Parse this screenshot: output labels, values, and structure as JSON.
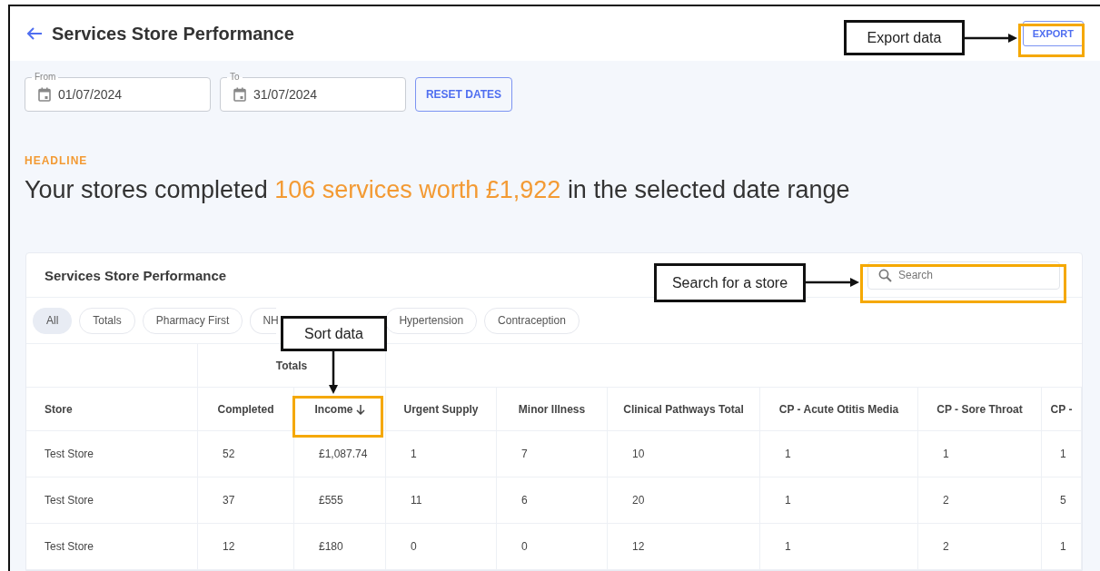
{
  "header": {
    "title": "Services Store Performance",
    "export_button": "EXPORT"
  },
  "date_range": {
    "from": {
      "label": "From",
      "value": "01/07/2024"
    },
    "to": {
      "label": "To",
      "value": "31/07/2024"
    },
    "reset_button": "RESET DATES"
  },
  "headline": {
    "label": "HEADLINE",
    "prefix": "Your stores completed",
    "highlight": "106 services worth £1,922",
    "suffix": "in the selected date range"
  },
  "card": {
    "title": "Services Store Performance",
    "search": {
      "placeholder": "Search"
    },
    "chips": [
      {
        "label": "All",
        "selected": true
      },
      {
        "label": "Totals",
        "selected": false
      },
      {
        "label": "Pharmacy First",
        "selected": false
      },
      {
        "label": "NH",
        "selected": false
      },
      {
        "label": "Hypertension",
        "selected": false
      },
      {
        "label": "Contraception",
        "selected": false
      }
    ],
    "group_header": "Totals",
    "columns": [
      {
        "label": "Store",
        "sorted": false
      },
      {
        "label": "Completed",
        "sorted": false
      },
      {
        "label": "Income",
        "sorted": true
      },
      {
        "label": "Urgent Supply",
        "sorted": false
      },
      {
        "label": "Minor Illness",
        "sorted": false
      },
      {
        "label": "Clinical Pathways Total",
        "sorted": false
      },
      {
        "label": "CP - Acute Otitis Media",
        "sorted": false
      },
      {
        "label": "CP - Sore Throat",
        "sorted": false
      },
      {
        "label": "CP -",
        "sorted": false
      }
    ],
    "rows": [
      [
        "Test Store",
        "52",
        "£1,087.74",
        "1",
        "7",
        "10",
        "1",
        "1",
        "1"
      ],
      [
        "Test Store",
        "37",
        "£555",
        "11",
        "6",
        "20",
        "1",
        "2",
        "5"
      ],
      [
        "Test Store",
        "12",
        "£180",
        "0",
        "0",
        "12",
        "1",
        "2",
        "1"
      ]
    ]
  },
  "annotations": [
    {
      "text": "Export data"
    },
    {
      "text": "Search for a store"
    },
    {
      "text": "Sort data"
    }
  ]
}
